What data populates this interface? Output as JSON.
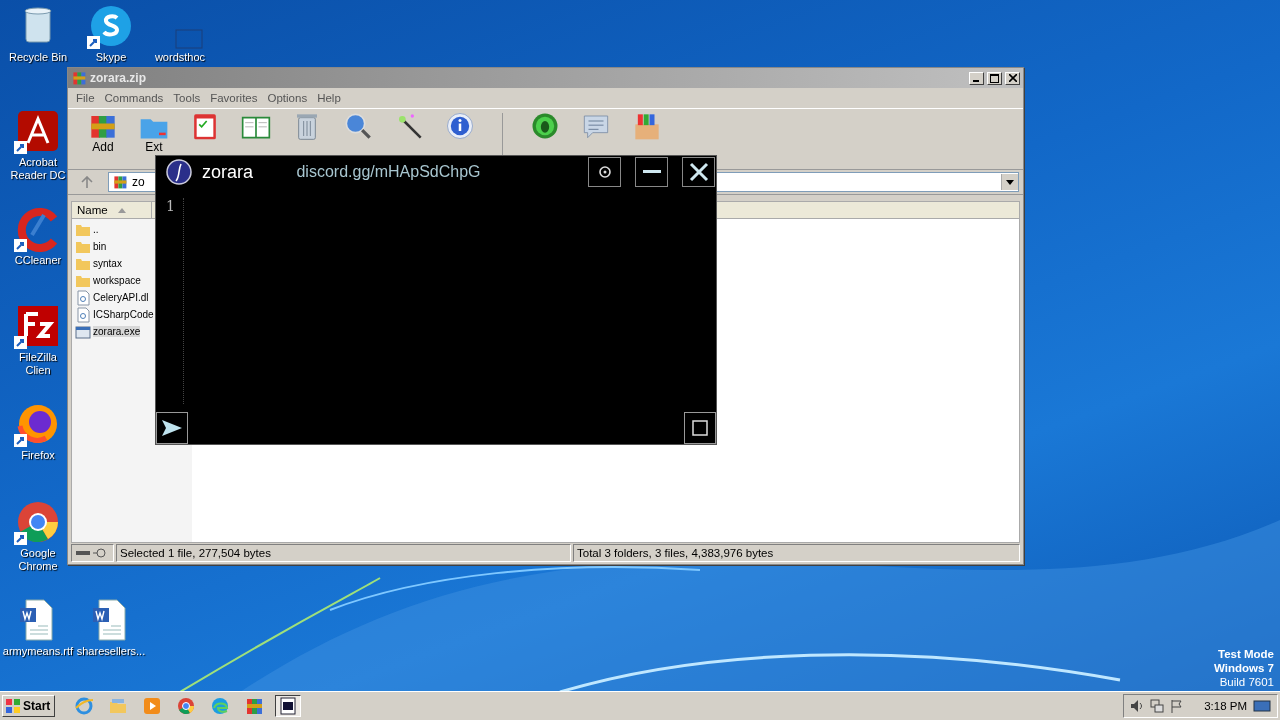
{
  "desktop": {
    "icons": [
      {
        "label": "Recycle Bin",
        "kind": "recycle",
        "shortcut": false
      },
      {
        "label": "Skype",
        "kind": "skype",
        "shortcut": true
      },
      {
        "label": "wordsthoc",
        "kind": "blank",
        "shortcut": false
      },
      {
        "label": "Acrobat Reader DC",
        "kind": "acrobat",
        "shortcut": true
      },
      {
        "label": "CCleaner",
        "kind": "ccleaner",
        "shortcut": true
      },
      {
        "label": "FileZilla Clien",
        "kind": "filezilla",
        "shortcut": true
      },
      {
        "label": "Firefox",
        "kind": "firefox",
        "shortcut": true
      },
      {
        "label": "Google Chrome",
        "kind": "chrome",
        "shortcut": true
      },
      {
        "label": "armymeans.rtf",
        "kind": "word",
        "shortcut": false
      },
      {
        "label": "sharesellers...",
        "kind": "word",
        "shortcut": false
      }
    ],
    "system_notice": [
      "Test Mode",
      "Windows 7",
      "Build 7601"
    ]
  },
  "archive_window": {
    "title": "zorara.zip",
    "menu": [
      "File",
      "Commands",
      "Tools",
      "Favorites",
      "Options",
      "Help"
    ],
    "toolbar": [
      {
        "label": "Add",
        "kind": "add"
      },
      {
        "label": "Ext",
        "kind": "extract"
      },
      {
        "kind": "test"
      },
      {
        "kind": "view"
      },
      {
        "kind": "delete"
      },
      {
        "kind": "find"
      },
      {
        "kind": "wizard"
      },
      {
        "kind": "info"
      },
      {
        "kind": "virus"
      },
      {
        "kind": "comment"
      },
      {
        "kind": "sfx"
      }
    ],
    "address": "zo",
    "columns": [
      "Name"
    ],
    "files": [
      {
        "name": "..",
        "kind": "folder",
        "selected": false
      },
      {
        "name": "bin",
        "kind": "folder",
        "selected": false
      },
      {
        "name": "syntax",
        "kind": "folder",
        "selected": false
      },
      {
        "name": "workspace",
        "kind": "folder",
        "selected": false
      },
      {
        "name": "CeleryAPI.dl",
        "kind": "dll",
        "selected": false
      },
      {
        "name": "ICSharpCode",
        "kind": "dll",
        "selected": false
      },
      {
        "name": "zorara.exe",
        "kind": "exe",
        "selected": true
      }
    ],
    "status": [
      "Selected 1 file, 277,504 bytes",
      "Total 3 folders, 3 files, 4,383,976 bytes"
    ]
  },
  "editor_window": {
    "title": "zorara",
    "link": "discord.gg/mHApSdChpG",
    "line_numbers": [
      "1"
    ]
  },
  "taskbar": {
    "start": "Start",
    "apps": [
      {
        "kind": "ie",
        "selected": false
      },
      {
        "kind": "explorer",
        "selected": false
      },
      {
        "kind": "media",
        "selected": false
      },
      {
        "kind": "chrome",
        "selected": false
      },
      {
        "kind": "edge",
        "selected": false
      },
      {
        "kind": "winrar",
        "selected": false
      },
      {
        "kind": "editor",
        "selected": true
      }
    ],
    "clock": "3:18 PM"
  }
}
